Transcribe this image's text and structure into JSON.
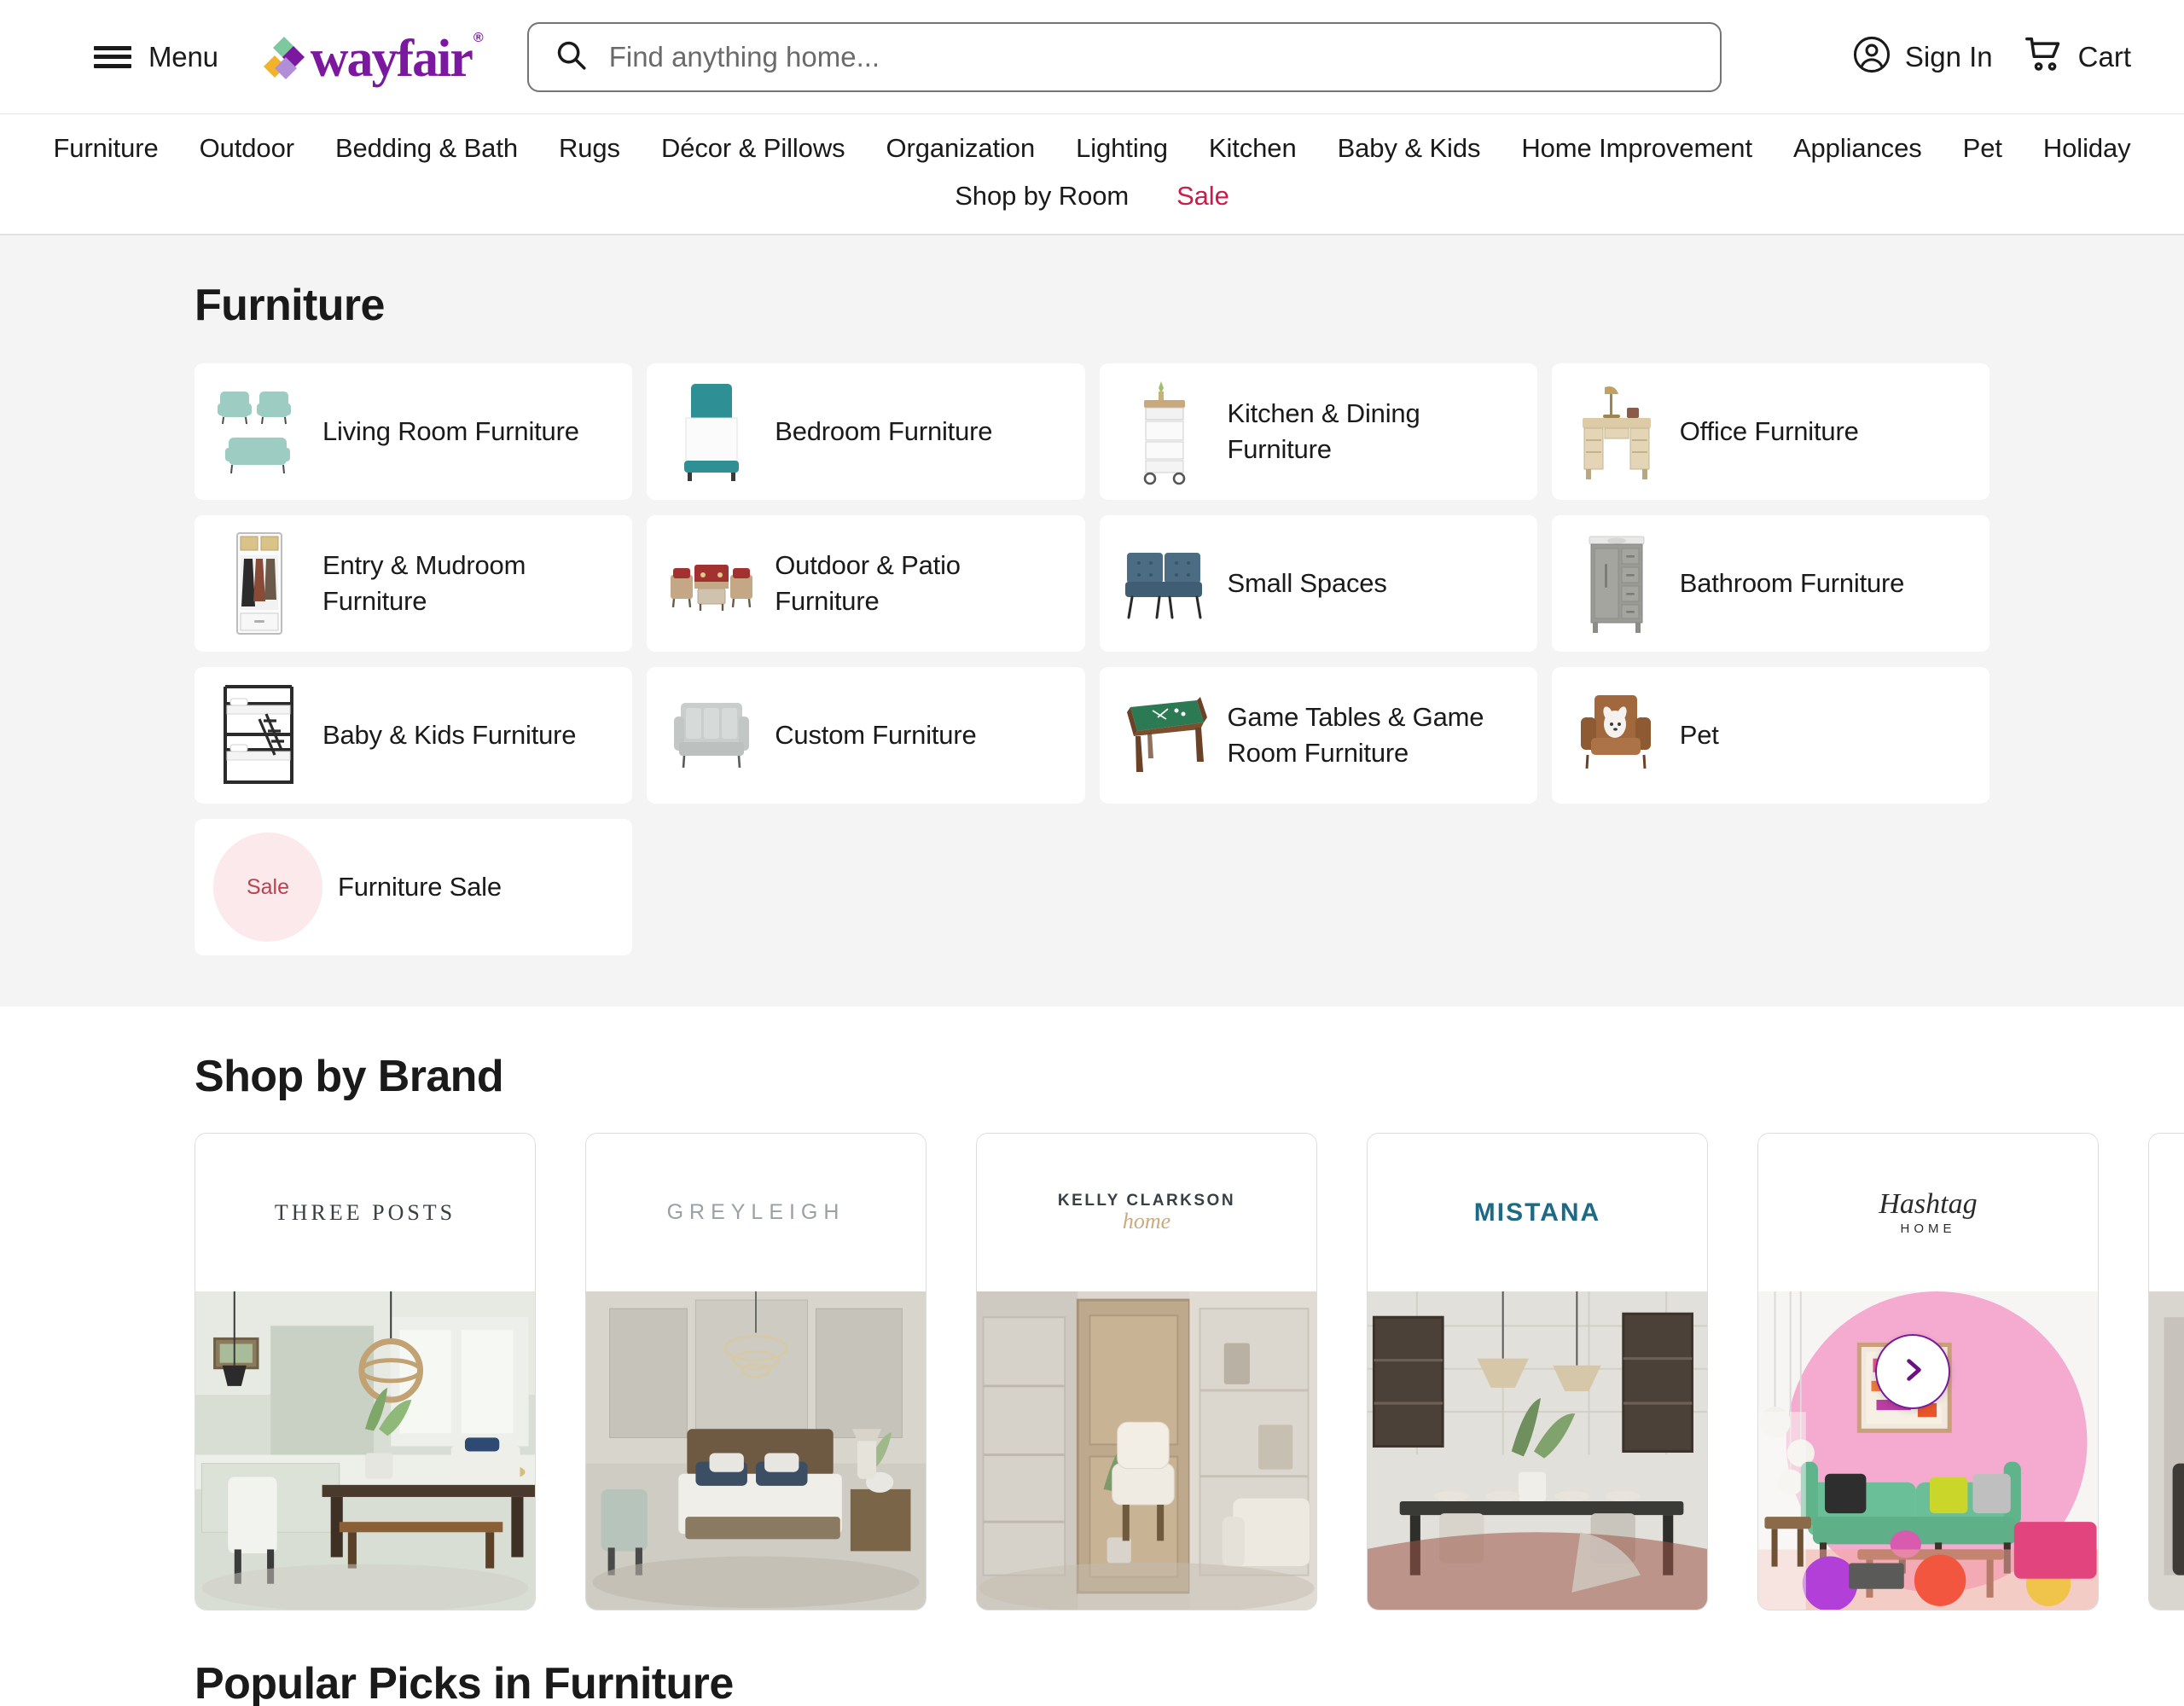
{
  "header": {
    "menu_label": "Menu",
    "logo_text": "wayfair",
    "logo_reg": "®",
    "search_placeholder": "Find anything home...",
    "search_value": "",
    "sign_in_label": "Sign In",
    "cart_label": "Cart",
    "icons": {
      "hamburger": "hamburger-menu-icon",
      "search": "search-icon",
      "account": "account-circle-icon",
      "cart": "shopping-cart-icon"
    }
  },
  "nav": {
    "row1": [
      "Furniture",
      "Outdoor",
      "Bedding & Bath",
      "Rugs",
      "Décor & Pillows",
      "Organization",
      "Lighting",
      "Kitchen",
      "Baby & Kids",
      "Home Improvement",
      "Appliances",
      "Pet",
      "Holiday"
    ],
    "row2": [
      {
        "label": "Shop by Room",
        "accent": false
      },
      {
        "label": "Sale",
        "accent": true
      }
    ],
    "sale_color": "#CB1B4A"
  },
  "category_section": {
    "title": "Furniture",
    "cards": [
      {
        "label": "Living Room Furniture",
        "thumb": "armchairs-and-sofa-thumb"
      },
      {
        "label": "Bedroom Furniture",
        "thumb": "teal-bed-thumb"
      },
      {
        "label": "Kitchen & Dining Furniture",
        "thumb": "kitchen-cart-thumb"
      },
      {
        "label": "Office Furniture",
        "thumb": "desk-with-lamp-thumb"
      },
      {
        "label": "Entry & Mudroom Furniture",
        "thumb": "mudroom-locker-thumb"
      },
      {
        "label": "Outdoor & Patio Furniture",
        "thumb": "patio-set-thumb"
      },
      {
        "label": "Small Spaces",
        "thumb": "blue-settee-thumb"
      },
      {
        "label": "Bathroom Furniture",
        "thumb": "gray-vanity-thumb"
      },
      {
        "label": "Baby & Kids Furniture",
        "thumb": "bunk-bed-thumb"
      },
      {
        "label": "Custom Furniture",
        "thumb": "gray-sofa-thumb"
      },
      {
        "label": "Game Tables & Game Room Furniture",
        "thumb": "pool-table-thumb"
      },
      {
        "label": "Pet",
        "thumb": "pet-sofa-thumb"
      }
    ],
    "sale_card": {
      "badge": "Sale",
      "label": "Furniture Sale",
      "badge_bg": "#FBE9EC",
      "badge_color": "#B7434F"
    }
  },
  "brand_section": {
    "title": "Shop by Brand",
    "next_button_label": "chevron-right-icon",
    "accent_color": "#7B189F",
    "brands": [
      {
        "name": "THREE POSTS",
        "logo_style": "threeposts",
        "scene": "green-kitchen-dining-room"
      },
      {
        "name": "GREYLEIGH",
        "logo_style": "greyleigh",
        "scene": "rustic-bedroom"
      },
      {
        "name": "KELLY CLARKSON",
        "sub": "home",
        "logo_style": "kelly",
        "scene": "neutral-office-nook"
      },
      {
        "name": "MISTANA",
        "logo_style": "mistana",
        "scene": "modern-dining-room"
      },
      {
        "name": "Hashtag",
        "sub": "HOME",
        "logo_style": "hashtag",
        "scene": "pink-wall-green-sofa"
      }
    ]
  },
  "picks_section": {
    "title": "Popular Picks in Furniture"
  }
}
